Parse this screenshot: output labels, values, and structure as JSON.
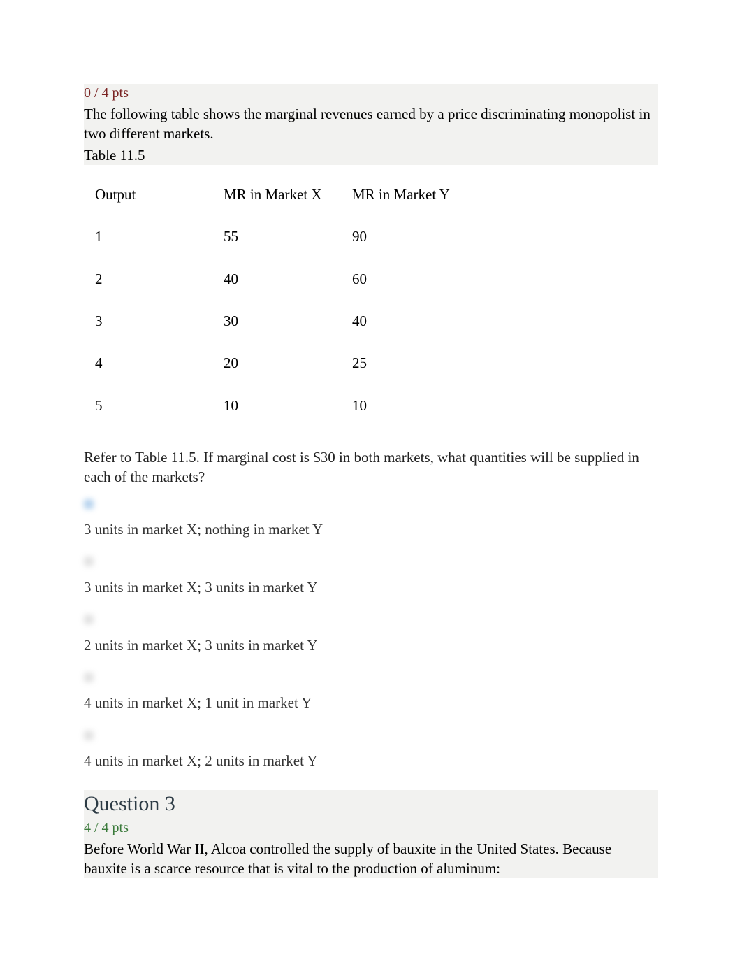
{
  "q2": {
    "score": "0 / 4 pts",
    "prompt": "The following table shows the marginal revenues earned by a price discriminating monopolist in two different markets.",
    "table_label": "Table 11.5",
    "headers": {
      "c0": "Output",
      "c1": "MR in Market X",
      "c2_pre": "MR",
      "c2_post": "  in Market Y"
    },
    "rows": [
      {
        "c0": "1",
        "c1": "55",
        "c2": "90"
      },
      {
        "c0": "2",
        "c1": "40",
        "c2": "60"
      },
      {
        "c0": "3",
        "c1": "30",
        "c2": "40"
      },
      {
        "c0": "4",
        "c1": "20",
        "c2": "25"
      },
      {
        "c0": "5",
        "c1": "10",
        "c2": "10"
      }
    ],
    "followup": "Refer to Table 11.5. If marginal cost is $30 in both markets, what quantities will be supplied in each of the markets?",
    "options": [
      "3 units in market X; nothing in market Y",
      "3 units in market X; 3 units in market Y",
      "2 units in market X; 3 units in market Y",
      "4 units in market X; 1 unit in market Y",
      "4 units in market X; 2 units in market Y"
    ]
  },
  "q3": {
    "heading": "Question 3",
    "score": "4 / 4 pts",
    "prompt": "Before World War II, Alcoa controlled the supply of bauxite in the United States. Because bauxite is a scarce resource that is vital to the production of aluminum:"
  }
}
